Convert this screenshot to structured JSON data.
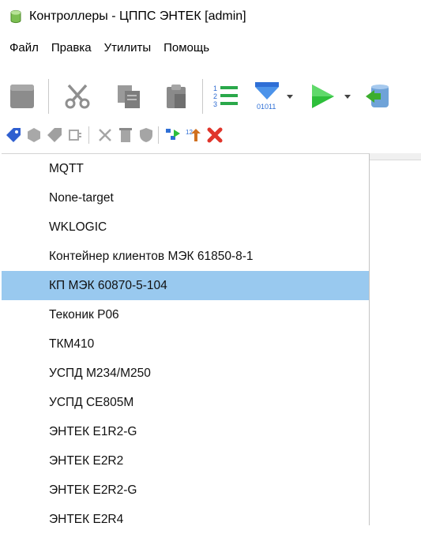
{
  "window": {
    "title": "Контроллеры - ЦППС ЭНТЕК [admin]",
    "icon": "database-icon"
  },
  "menu": [
    {
      "label": "Файл"
    },
    {
      "label": "Правка"
    },
    {
      "label": "Утилиты"
    },
    {
      "label": "Помощь"
    }
  ],
  "toolbar": {
    "icons": [
      "stop-icon",
      "cut-icon",
      "copy-icon",
      "paste-icon",
      "numbered-list-icon",
      "download-binary-icon",
      "run-icon",
      "database-export-icon"
    ]
  },
  "toolbar2": {
    "icons": [
      "tag-icon",
      "hexagon-icon",
      "tag-gray-icon",
      "plugin-icon",
      "cut-gray-icon",
      "delete-gray-icon",
      "shield-gray-icon",
      "tree-export-icon",
      "sort-icon",
      "delete-red-icon"
    ]
  },
  "dropdown": {
    "selected_index": 4,
    "items": [
      {
        "label": "MQTT"
      },
      {
        "label": "None-target"
      },
      {
        "label": "WKLOGIC"
      },
      {
        "label": "Контейнер клиентов МЭК 61850-8-1"
      },
      {
        "label": "КП МЭК 60870-5-104"
      },
      {
        "label": "Теконик Р06"
      },
      {
        "label": "ТКМ410"
      },
      {
        "label": "УСПД М234/М250"
      },
      {
        "label": "УСПД СЕ805М"
      },
      {
        "label": "ЭНТЕК E1R2-G"
      },
      {
        "label": "ЭНТЕК E2R2"
      },
      {
        "label": "ЭНТЕК E2R2-G"
      },
      {
        "label": "ЭНТЕК E2R4"
      }
    ]
  },
  "colors": {
    "selection": "#99c9ef",
    "run_green": "#2dbf3a",
    "accent_blue": "#2f6fd6"
  }
}
